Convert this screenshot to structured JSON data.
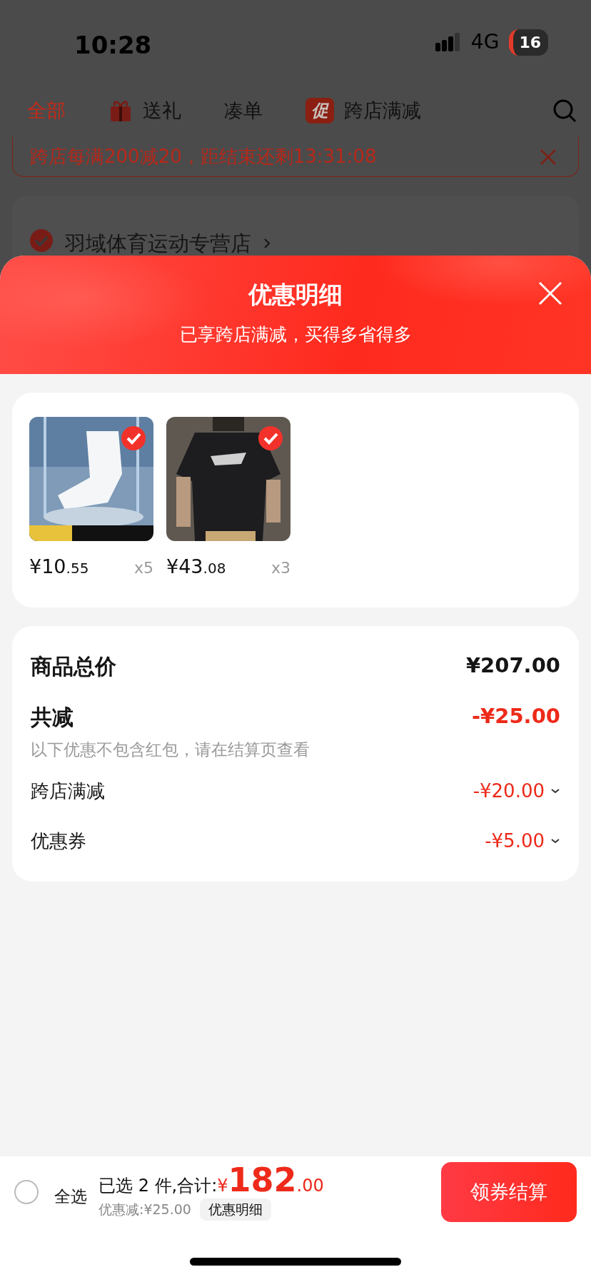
{
  "status_bar": {
    "time": "10:28",
    "network": "4G",
    "battery": "16"
  },
  "tabs": [
    {
      "label": "全部",
      "selected": true,
      "kind": "plain"
    },
    {
      "label": "送礼",
      "selected": false,
      "kind": "gift"
    },
    {
      "label": "凑单",
      "selected": false,
      "kind": "plain"
    },
    {
      "label": "跨店满减",
      "selected": false,
      "kind": "promo",
      "badge": "促"
    }
  ],
  "promo_banner": {
    "text": "跨店每满200减20，距结束还剩13:31:08"
  },
  "store": {
    "name": "羽域体育运动专营店",
    "checked": true
  },
  "sheet": {
    "title": "优惠明细",
    "subtitle": "已享跨店满减，买得多省得多"
  },
  "products": [
    {
      "price_main": "¥10",
      "price_cents": ".55",
      "quantity": "x5",
      "selected": true
    },
    {
      "price_main": "¥43",
      "price_cents": ".08",
      "quantity": "x3",
      "selected": true
    }
  ],
  "summary": {
    "total_label": "商品总价",
    "total": "¥207.00",
    "discount_label": "共减",
    "discount": "-¥25.00",
    "note": "以下优惠不包含红包，请在结算页查看",
    "items": [
      {
        "label": "跨店满减",
        "amount": "-¥20.00"
      },
      {
        "label": "优惠券",
        "amount": "-¥5.00"
      }
    ]
  },
  "checkout": {
    "select_all_label": "全选",
    "select_all_checked": false,
    "selected_text": "已选 2 件,合计:",
    "currency": "¥",
    "total_main": "182",
    "total_cents": ".00",
    "discount_text": "优惠减:¥25.00",
    "detail_button": "优惠明细",
    "button": "领券结算"
  }
}
